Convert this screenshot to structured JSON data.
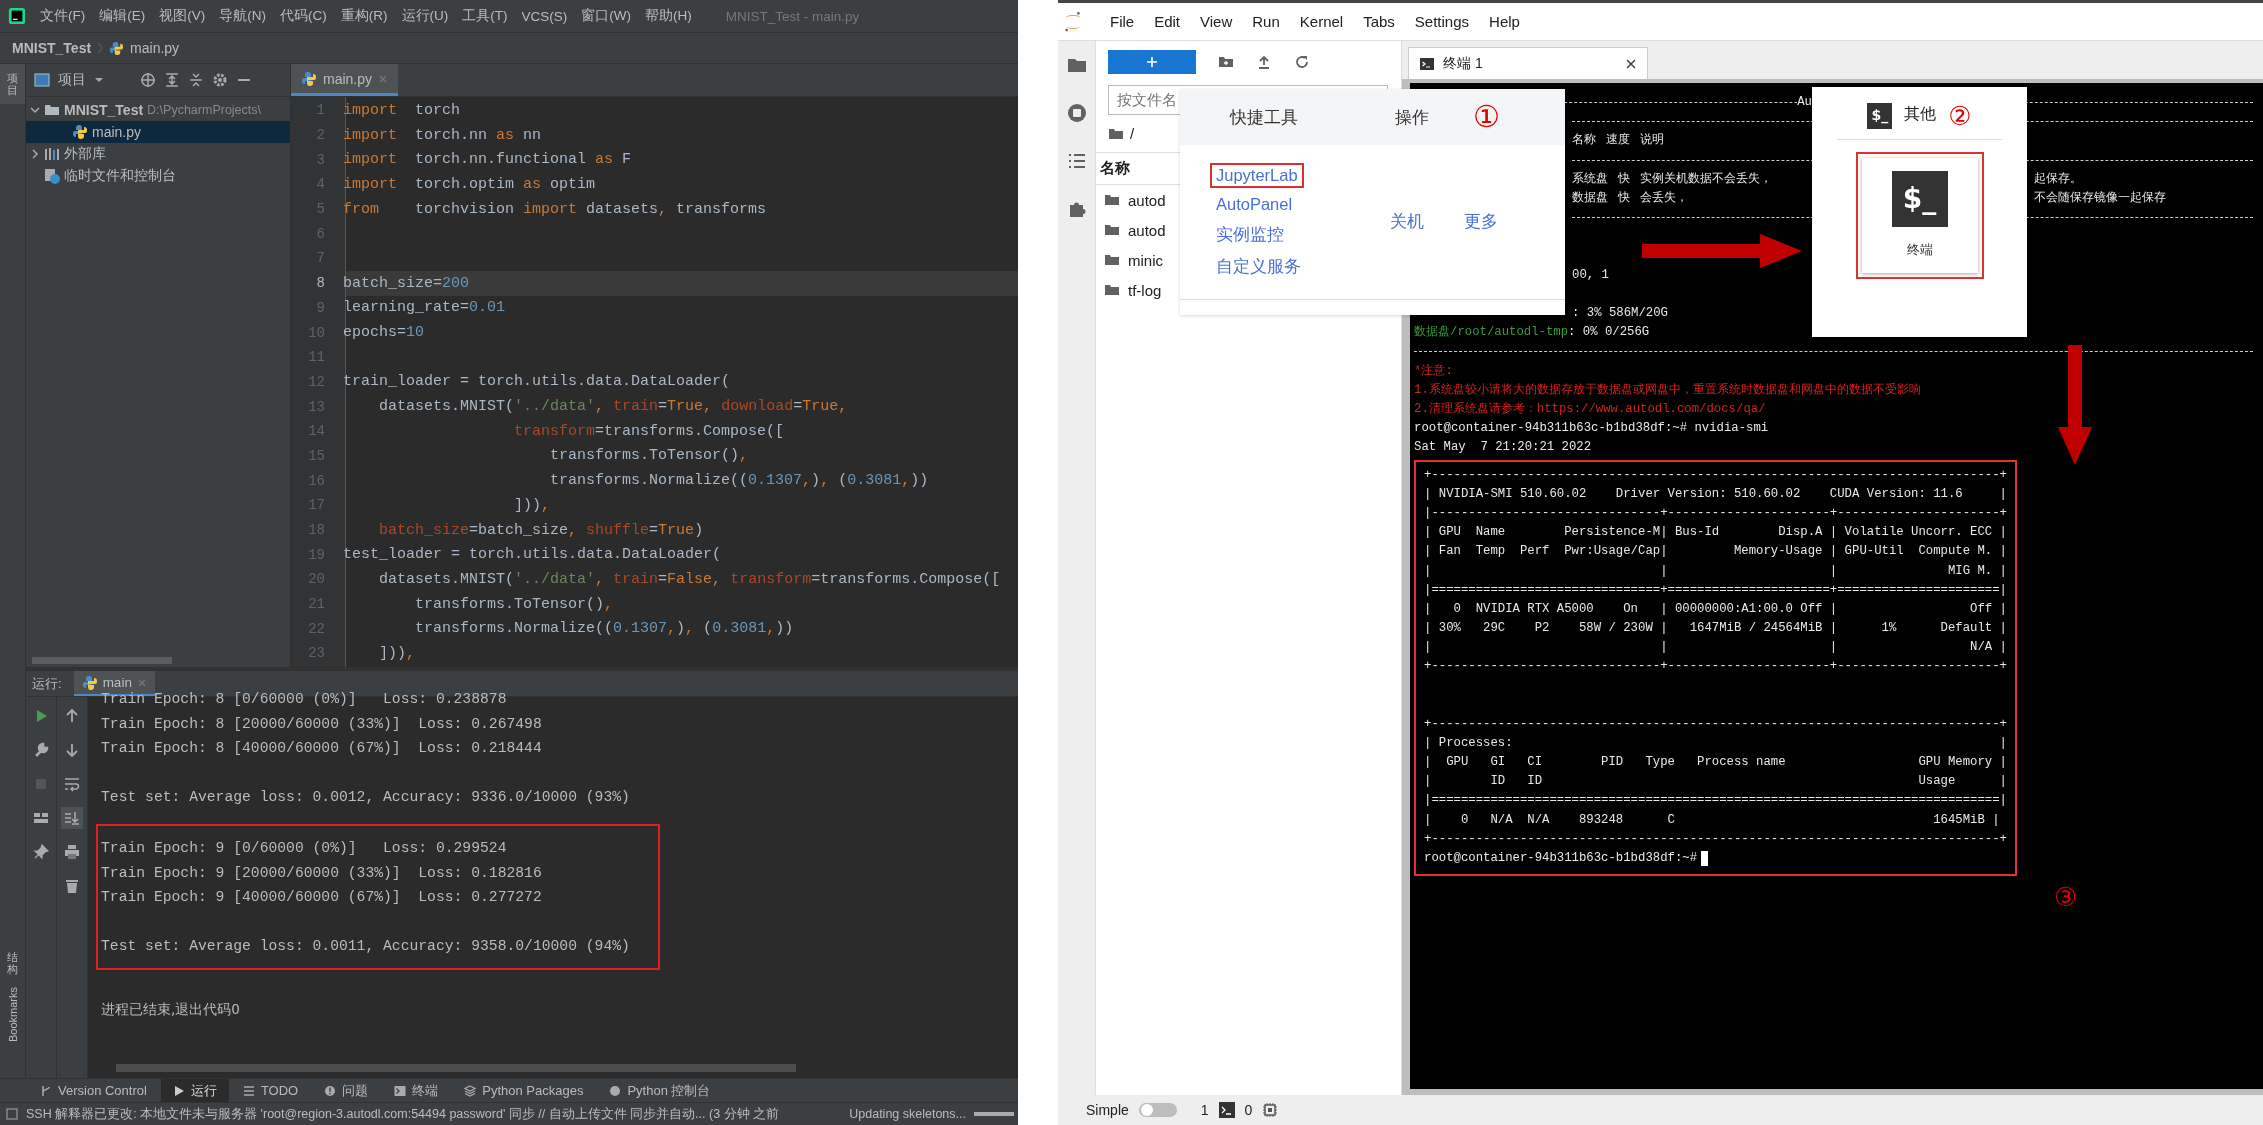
{
  "ide": {
    "menu": [
      "文件(F)",
      "编辑(E)",
      "视图(V)",
      "导航(N)",
      "代码(C)",
      "重构(R)",
      "运行(U)",
      "工具(T)",
      "VCS(S)",
      "窗口(W)",
      "帮助(H)"
    ],
    "window_title": "MNIST_Test - main.py",
    "breadcrumb": [
      "MNIST_Test",
      "main.py"
    ],
    "stripe_top": "项目",
    "stripe_bottom": [
      "结构",
      "Bookmarks"
    ],
    "project_panel": {
      "title": "项目",
      "tree": [
        {
          "label": "MNIST_Test",
          "path": "D:\\PycharmProjects\\",
          "expanded": true,
          "selected": false,
          "children": [
            {
              "label": "main.py",
              "selected": true
            }
          ]
        },
        {
          "label": "外部库",
          "expanded": false,
          "selected": false
        },
        {
          "label": "临时文件和控制台",
          "selected": false
        }
      ]
    },
    "editor_tab": "main.py",
    "code_lines": [
      {
        "number": "1",
        "current": false,
        "segments": [
          {
            "kind": "kw",
            "text": "import"
          },
          {
            "kind": "txt",
            "text": "  torch"
          }
        ]
      },
      {
        "number": "2",
        "current": false,
        "segments": [
          {
            "kind": "kw",
            "text": "import"
          },
          {
            "kind": "txt",
            "text": "  torch.nn "
          },
          {
            "kind": "kw",
            "text": "as"
          },
          {
            "kind": "txt",
            "text": " nn"
          }
        ]
      },
      {
        "number": "3",
        "current": false,
        "segments": [
          {
            "kind": "kw",
            "text": "import"
          },
          {
            "kind": "txt",
            "text": "  torch.nn.functional "
          },
          {
            "kind": "kw",
            "text": "as"
          },
          {
            "kind": "txt",
            "text": " F"
          }
        ]
      },
      {
        "number": "4",
        "current": false,
        "segments": [
          {
            "kind": "kw",
            "text": "import"
          },
          {
            "kind": "txt",
            "text": "  torch.optim "
          },
          {
            "kind": "kw",
            "text": "as"
          },
          {
            "kind": "txt",
            "text": " optim"
          }
        ]
      },
      {
        "number": "5",
        "current": false,
        "segments": [
          {
            "kind": "kw",
            "text": "from"
          },
          {
            "kind": "txt",
            "text": "    torchvision "
          },
          {
            "kind": "kw",
            "text": "import"
          },
          {
            "kind": "txt",
            "text": " datasets"
          },
          {
            "kind": "kw",
            "text": ","
          },
          {
            "kind": "txt",
            "text": " transforms"
          }
        ]
      },
      {
        "number": "6",
        "current": false
      },
      {
        "number": "7",
        "current": false
      },
      {
        "number": "8",
        "current": true,
        "segments": [
          {
            "kind": "txt",
            "text": "batch_size="
          },
          {
            "kind": "num",
            "text": "200"
          }
        ]
      },
      {
        "number": "9",
        "current": false,
        "segments": [
          {
            "kind": "txt",
            "text": "learning_rate="
          },
          {
            "kind": "num",
            "text": "0.01"
          }
        ]
      },
      {
        "number": "10",
        "current": false,
        "segments": [
          {
            "kind": "txt",
            "text": "epochs="
          },
          {
            "kind": "num",
            "text": "10"
          }
        ]
      },
      {
        "number": "11",
        "current": false
      },
      {
        "number": "12",
        "current": false,
        "segments": [
          {
            "kind": "txt",
            "text": "train_loader = torch.utils.data.DataLoader("
          }
        ]
      },
      {
        "number": "13",
        "current": false,
        "segments": [
          {
            "kind": "txt",
            "text": "    datasets.MNIST("
          },
          {
            "kind": "str",
            "text": "'../data'"
          },
          {
            "kind": "kw",
            "text": ","
          },
          {
            "kind": "arg",
            "text": " train"
          },
          {
            "kind": "txt",
            "text": "="
          },
          {
            "kind": "kw",
            "text": "True"
          },
          {
            "kind": "kw",
            "text": ","
          },
          {
            "kind": "arg",
            "text": " download"
          },
          {
            "kind": "txt",
            "text": "="
          },
          {
            "kind": "kw",
            "text": "True"
          },
          {
            "kind": "kw",
            "text": ","
          }
        ]
      },
      {
        "number": "14",
        "current": false,
        "segments": [
          {
            "kind": "arg",
            "text": "                   transform"
          },
          {
            "kind": "txt",
            "text": "=transforms.Compose(["
          }
        ]
      },
      {
        "number": "15",
        "current": false,
        "segments": [
          {
            "kind": "txt",
            "text": "                       transforms.ToTensor()"
          },
          {
            "kind": "kw",
            "text": ","
          }
        ]
      },
      {
        "number": "16",
        "current": false,
        "segments": [
          {
            "kind": "txt",
            "text": "                       transforms.Normalize(("
          },
          {
            "kind": "num",
            "text": "0.1307"
          },
          {
            "kind": "kw",
            "text": ","
          },
          {
            "kind": "txt",
            "text": ")"
          },
          {
            "kind": "kw",
            "text": ","
          },
          {
            "kind": "txt",
            "text": " ("
          },
          {
            "kind": "num",
            "text": "0.3081"
          },
          {
            "kind": "kw",
            "text": ","
          },
          {
            "kind": "txt",
            "text": "))"
          }
        ]
      },
      {
        "number": "17",
        "current": false,
        "segments": [
          {
            "kind": "txt",
            "text": "                   ]))"
          },
          {
            "kind": "kw",
            "text": ","
          }
        ]
      },
      {
        "number": "18",
        "current": false,
        "segments": [
          {
            "kind": "arg",
            "text": "    batch_size"
          },
          {
            "kind": "txt",
            "text": "=batch_size"
          },
          {
            "kind": "kw",
            "text": ","
          },
          {
            "kind": "arg",
            "text": " shuffle"
          },
          {
            "kind": "txt",
            "text": "="
          },
          {
            "kind": "kw",
            "text": "True"
          },
          {
            "kind": "txt",
            "text": ")"
          }
        ]
      },
      {
        "number": "19",
        "current": false,
        "segments": [
          {
            "kind": "txt",
            "text": "test_loader = torch.utils.data.DataLoader("
          }
        ]
      },
      {
        "number": "20",
        "current": false,
        "segments": [
          {
            "kind": "txt",
            "text": "    datasets.MNIST("
          },
          {
            "kind": "str",
            "text": "'../data'"
          },
          {
            "kind": "kw",
            "text": ","
          },
          {
            "kind": "arg",
            "text": " train"
          },
          {
            "kind": "txt",
            "text": "="
          },
          {
            "kind": "kw",
            "text": "False"
          },
          {
            "kind": "kw",
            "text": ","
          },
          {
            "kind": "arg",
            "text": " transform"
          },
          {
            "kind": "txt",
            "text": "=transforms.Compose(["
          }
        ]
      },
      {
        "number": "21",
        "current": false,
        "segments": [
          {
            "kind": "txt",
            "text": "        transforms.ToTensor()"
          },
          {
            "kind": "kw",
            "text": ","
          }
        ]
      },
      {
        "number": "22",
        "current": false,
        "segments": [
          {
            "kind": "txt",
            "text": "        transforms.Normalize(("
          },
          {
            "kind": "num",
            "text": "0.1307"
          },
          {
            "kind": "kw",
            "text": ","
          },
          {
            "kind": "txt",
            "text": ")"
          },
          {
            "kind": "kw",
            "text": ","
          },
          {
            "kind": "txt",
            "text": " ("
          },
          {
            "kind": "num",
            "text": "0.3081"
          },
          {
            "kind": "kw",
            "text": ","
          },
          {
            "kind": "txt",
            "text": "))"
          }
        ]
      },
      {
        "number": "23",
        "current": false,
        "segments": [
          {
            "kind": "txt",
            "text": "    ]))"
          },
          {
            "kind": "kw",
            "text": ","
          }
        ]
      }
    ],
    "run_panel": {
      "label": "运行:",
      "tab": "main",
      "output": [
        {
          "highlighted": false,
          "paragraphs": [
            [
              "Train Epoch: 8 [0/60000 (0%)]   Loss: 0.238878",
              "Train Epoch: 8 [20000/60000 (33%)]  Loss: 0.267498",
              "Train Epoch: 8 [40000/60000 (67%)]  Loss: 0.218444"
            ],
            [
              "Test set: Average loss: 0.0012, Accuracy: 9336.0/10000 (93%)"
            ]
          ]
        },
        {
          "highlighted": true,
          "paragraphs": [
            [
              "Train Epoch: 9 [0/60000 (0%)]   Loss: 0.299524",
              "Train Epoch: 9 [20000/60000 (33%)]  Loss: 0.182816",
              "Train Epoch: 9 [40000/60000 (67%)]  Loss: 0.277272"
            ],
            [
              "Test set: Average loss: 0.0011, Accuracy: 9358.0/10000 (94%)"
            ]
          ]
        },
        {
          "highlighted": false,
          "paragraphs": [
            [
              "进程已结束,退出代码0"
            ]
          ]
        }
      ]
    },
    "tool_tabs": [
      {
        "label": "Version Control",
        "selected": false
      },
      {
        "label": "运行",
        "selected": true
      },
      {
        "label": "TODO",
        "selected": false
      },
      {
        "label": "问题",
        "selected": false
      },
      {
        "label": "终端",
        "selected": false
      },
      {
        "label": "Python Packages",
        "selected": false
      },
      {
        "label": "Python 控制台",
        "selected": false
      }
    ],
    "status": {
      "message": "SSH 解释器已更改: 本地文件未与服务器 'root@region-3.autodl.com:54494 password' 同步 // 自动上传文件   同步并自动... (3 分钟 之前",
      "task": "Updating skeletons..."
    }
  },
  "jupyter": {
    "menu": [
      "File",
      "Edit",
      "View",
      "Run",
      "Kernel",
      "Tabs",
      "Settings",
      "Help"
    ],
    "filter_placeholder": "按文件名",
    "path": "/",
    "column": "名称",
    "files": [
      "autod",
      "autod",
      "minic",
      "tf-log"
    ],
    "terminal_tab": "终端 1",
    "launcher_popup": {
      "tabs": [
        "快捷工具",
        "操作"
      ],
      "marker": "①",
      "links": [
        {
          "label": "JupyterLab",
          "highlighted": true
        },
        {
          "label": "AutoPanel",
          "highlighted": false
        },
        {
          "label": "实例监控",
          "highlighted": false
        },
        {
          "label": "自定义服务",
          "highlighted": false
        }
      ],
      "actions": [
        "关机",
        "更多"
      ]
    },
    "other_popup": {
      "icon_text": "$_",
      "title": "其他",
      "marker": "②",
      "card_icon_text": "$_",
      "card_label": "终端",
      "card_highlighted": true
    },
    "terminal": {
      "top_rows": [
        {
          "kind": "rule",
          "mid": [
            {
              "kind": "white",
              "text": "Au"
            }
          ]
        },
        {
          "kind": "table-rule"
        },
        {
          "kind": "text",
          "mid": [
            {
              "kind": "white",
              "text": "名称"
            },
            {
              "kind": "white",
              "text": "速度"
            },
            {
              "kind": "white",
              "text": "说明"
            }
          ]
        },
        {
          "kind": "table-rule"
        },
        {
          "kind": "text",
          "mid": [
            {
              "kind": "white",
              "text": "系统盘"
            },
            {
              "kind": "white",
              "text": "快"
            },
            {
              "kind": "white",
              "text": "实例关机数据不会丢失，"
            }
          ],
          "right": [
            {
              "kind": "white",
              "text": "起保存。"
            }
          ]
        },
        {
          "kind": "text",
          "mid": [
            {
              "kind": "white",
              "text": "数据盘"
            },
            {
              "kind": "white",
              "text": "快"
            },
            {
              "kind": "white",
              "text": "会丢失，"
            }
          ],
          "right": [
            {
              "kind": "white",
              "text": "不会随保存镜像一起保存"
            }
          ]
        },
        {
          "kind": "table-rule"
        },
        {
          "kind": "blank"
        },
        {
          "kind": "blank"
        },
        {
          "kind": "text",
          "mid": [
            {
              "kind": "white",
              "text": "00, 1"
            }
          ]
        },
        {
          "kind": "blank"
        },
        {
          "kind": "text",
          "mid": [
            {
              "kind": "white",
              "text": ": 3% 586M/20G"
            }
          ]
        },
        {
          "kind": "text",
          "full": [
            {
              "kind": "green",
              "text": "数据盘/root/autodl-tmp"
            },
            {
              "kind": "white",
              "text": ": 0% 0/256G"
            }
          ]
        },
        {
          "kind": "rule"
        }
      ],
      "lines": [
        {
          "kind": "red",
          "text": "*注意:"
        },
        {
          "kind": "red",
          "text": "1.系统盘较小请将大的数据存放于数据盘或网盘中，重置系统时数据盘和网盘中的数据不受影响"
        },
        {
          "kind": "red",
          "text": "2.清理系统盘请参考：https://www.autodl.com/docs/qa/"
        },
        {
          "kind": "white",
          "text": "root@container-94b311b63c-b1bd38df:~# nvidia-smi"
        },
        {
          "kind": "white",
          "text": "Sat May  7 21:20:21 2022"
        }
      ],
      "smi_highlighted": true,
      "smi_gpu": [
        "+-----------------------------------------------------------------------------+",
        "| NVIDIA-SMI 510.60.02    Driver Version: 510.60.02    CUDA Version: 11.6     |",
        "|-------------------------------+----------------------+----------------------+",
        "| GPU  Name        Persistence-M| Bus-Id        Disp.A | Volatile Uncorr. ECC |",
        "| Fan  Temp  Perf  Pwr:Usage/Cap|         Memory-Usage | GPU-Util  Compute M. |",
        "|                               |                      |               MIG M. |",
        "|===============================+======================+======================|",
        "|   0  NVIDIA RTX A5000    On   | 00000000:A1:00.0 Off |                  Off |",
        "| 30%   29C    P2    58W / 230W |   1647MiB / 24564MiB |      1%      Default |",
        "|                               |                      |                  N/A |",
        "+-------------------------------+----------------------+----------------------+"
      ],
      "smi_proc": [
        "+-----------------------------------------------------------------------------+",
        "| Processes:                                                                  |",
        "|  GPU   GI   CI        PID   Type   Process name                  GPU Memory |",
        "|        ID   ID                                                   Usage      |",
        "|=============================================================================|",
        "|    0   N/A  N/A    893248      C                                   1645MiB |",
        "+-----------------------------------------------------------------------------+"
      ],
      "prompt": "root@container-94b311b63c-b1bd38df:~#",
      "marker": "③"
    },
    "status": {
      "mode": "Simple",
      "toggle_on": false,
      "terminals": "1",
      "kernels": "0"
    }
  }
}
